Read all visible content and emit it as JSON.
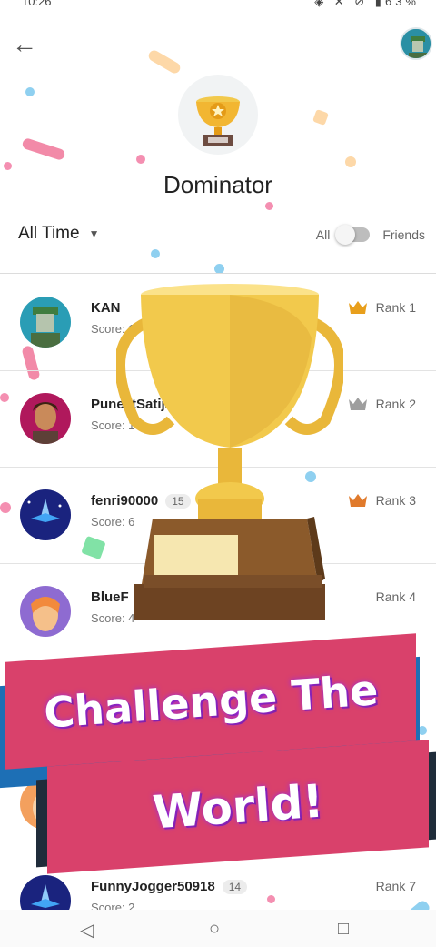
{
  "status": {
    "time": "10:26",
    "battery": "63%"
  },
  "header": {
    "title": "Dominator"
  },
  "filter": {
    "time_range": "All Time",
    "toggle_left": "All",
    "toggle_right": "Friends"
  },
  "players": [
    {
      "name": "KAN",
      "score": "Score: 1",
      "rank": "Rank 1",
      "crown_color": "#e89f1c"
    },
    {
      "name": "PuneetSatija",
      "score": "Score: 10",
      "rank": "Rank 2",
      "crown_color": "#9e9e9e"
    },
    {
      "name": "fenri90000",
      "level": "15",
      "score": "Score: 6",
      "rank": "Rank 3",
      "crown_color": "#e07a2c"
    },
    {
      "name": "BlueF",
      "score": "Score: 4",
      "rank": "Rank 4",
      "crown_color": ""
    },
    {
      "name": "FunnyJogger50918",
      "level": "14",
      "score": "Score: 2",
      "rank": "Rank 7",
      "crown_color": ""
    }
  ],
  "banner": {
    "line1": "Challenge The",
    "line2": "World!"
  },
  "colors": {
    "banner": "#d9416b",
    "banner_shadow_blue": "#1d6fb5",
    "trophy_gold": "#f2c94c",
    "trophy_wood": "#8b5a2b"
  },
  "icons": {
    "back": "arrow-left-icon",
    "crown": "crown-icon",
    "home": "circle-home-icon",
    "back_nav": "triangle-back-icon",
    "recents": "square-recents-icon"
  }
}
